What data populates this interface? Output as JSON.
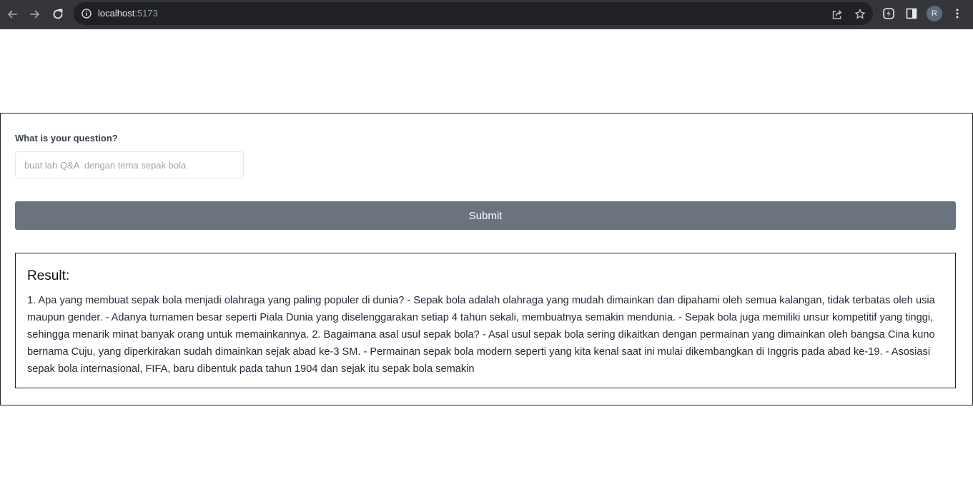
{
  "browser": {
    "url_host": "localhost",
    "url_port": ":5173",
    "profile_initial": "R"
  },
  "form": {
    "question_label": "What is your question?",
    "question_value": "",
    "question_placeholder": "buat lah Q&A  dengan tema sepak bola",
    "submit_label": "Submit"
  },
  "result": {
    "title": "Result:",
    "text": "1. Apa yang membuat sepak bola menjadi olahraga yang paling populer di dunia? - Sepak bola adalah olahraga yang mudah dimainkan dan dipahami oleh semua kalangan, tidak terbatas oleh usia maupun gender. - Adanya turnamen besar seperti Piala Dunia yang diselenggarakan setiap 4 tahun sekali, membuatnya semakin mendunia. - Sepak bola juga memiliki unsur kompetitif yang tinggi, sehingga menarik minat banyak orang untuk memainkannya. 2. Bagaimana asal usul sepak bola? - Asal usul sepak bola sering dikaitkan dengan permainan yang dimainkan oleh bangsa Cina kuno bernama Cuju, yang diperkirakan sudah dimainkan sejak abad ke-3 SM. - Permainan sepak bola modern seperti yang kita kenal saat ini mulai dikembangkan di Inggris pada abad ke-19. - Asosiasi sepak bola internasional, FIFA, baru dibentuk pada tahun 1904 dan sejak itu sepak bola semakin"
  },
  "icons": {
    "back": "arrow-left-icon",
    "forward": "arrow-right-icon",
    "reload": "reload-icon",
    "site_info": "info-icon",
    "share": "share-icon",
    "bookmark": "star-icon",
    "extension": "extension-icon",
    "side_panel": "side-panel-icon",
    "menu": "kebab-menu-icon"
  },
  "colors": {
    "chrome_bg": "#35363a",
    "omnibox_bg": "#202124",
    "submit_bg": "#6b7280",
    "avatar_bg": "#5c6c7e"
  }
}
